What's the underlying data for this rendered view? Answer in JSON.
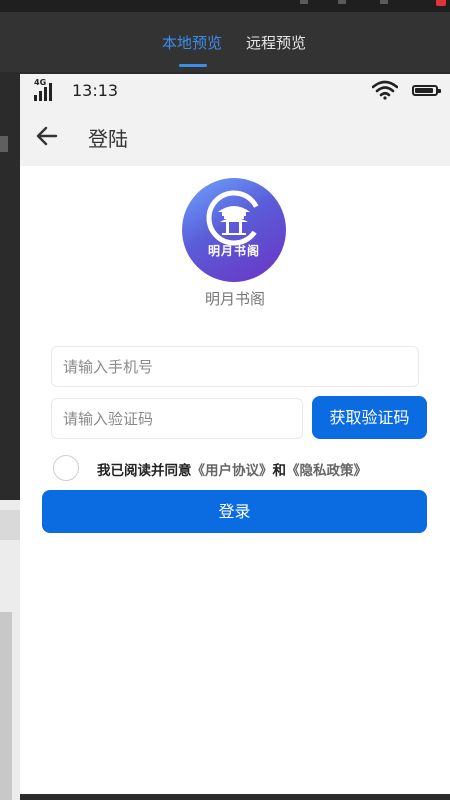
{
  "preview_tabs": [
    {
      "label": "本地预览",
      "active": true
    },
    {
      "label": "远程预览",
      "active": false
    }
  ],
  "status_bar": {
    "network": "4G",
    "time": "13:13"
  },
  "nav": {
    "title": "登陆"
  },
  "app": {
    "logo_text": "明月书阁",
    "name": "明月书阁"
  },
  "form": {
    "phone_placeholder": "请输入手机号",
    "code_placeholder": "请输入验证码",
    "get_code_label": "获取验证码",
    "agreement_prefix": "我已阅读并同意",
    "user_agreement": "《用户协议》",
    "and": "和",
    "privacy_policy": "《隐私政策》",
    "login_label": "登录"
  },
  "colors": {
    "accent": "#0b6be0",
    "tab_active": "#3c8dea"
  }
}
